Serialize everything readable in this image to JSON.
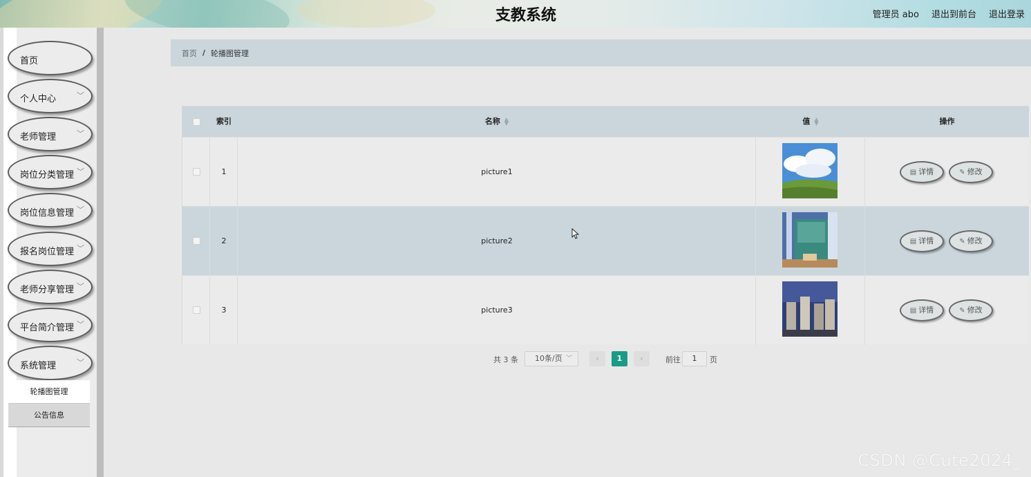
{
  "header": {
    "title": "支教系统",
    "user_label": "管理员 abo",
    "back_to_front": "退出到前台",
    "logout": "退出登录"
  },
  "sidebar": {
    "items": [
      {
        "label": "首页",
        "has_children": false
      },
      {
        "label": "个人中心",
        "has_children": true
      },
      {
        "label": "老师管理",
        "has_children": true
      },
      {
        "label": "岗位分类管理",
        "has_children": true
      },
      {
        "label": "岗位信息管理",
        "has_children": true
      },
      {
        "label": "报名岗位管理",
        "has_children": true
      },
      {
        "label": "老师分享管理",
        "has_children": true
      },
      {
        "label": "平台简介管理",
        "has_children": true
      },
      {
        "label": "系统管理",
        "has_children": true
      }
    ],
    "sub_items": [
      {
        "label": "轮播图管理",
        "active": true
      },
      {
        "label": "公告信息",
        "active": false
      }
    ],
    "chevron": "﹀"
  },
  "breadcrumb": {
    "home": "首页",
    "separator": "/",
    "current": "轮播图管理"
  },
  "table": {
    "headers": {
      "index": "索引",
      "name": "名称",
      "value": "值",
      "actions": "操作"
    },
    "rows": [
      {
        "index": "1",
        "name": "picture1",
        "image": "sky-meadow"
      },
      {
        "index": "2",
        "name": "picture2",
        "image": "classroom"
      },
      {
        "index": "3",
        "name": "picture3",
        "image": "desks"
      }
    ],
    "detail_label": "详情",
    "edit_label": "修改"
  },
  "pagination": {
    "total_text": "共 3 条",
    "page_size": "10条/页",
    "current_page": "1",
    "goto_label": "前往",
    "goto_value": "1",
    "page_unit": "页"
  },
  "watermark": "CSDN @Cute2024_",
  "colors": {
    "accent": "#1a9b86",
    "header_row": "#cad6dc"
  }
}
